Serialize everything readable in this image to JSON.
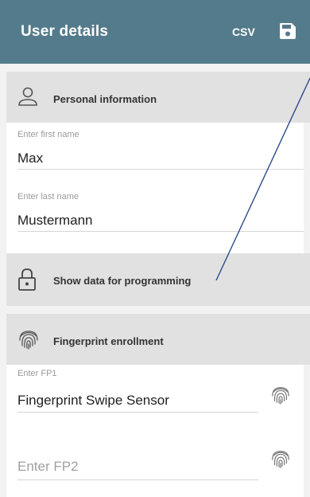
{
  "appbar": {
    "title": "User details",
    "csv_label": "CSV",
    "save_icon": "save-icon",
    "color": "#547b8b"
  },
  "sections": {
    "personal": {
      "label": "Personal information",
      "icon": "person-icon"
    },
    "programming": {
      "label": "Show data for programming",
      "icon": "lock-icon"
    },
    "fingerprint": {
      "label": "Fingerprint enrollment",
      "icon": "fingerprint-icon"
    }
  },
  "fields": {
    "first_name": {
      "label": "Enter first name",
      "value": "Max"
    },
    "last_name": {
      "label": "Enter last name",
      "value": "Mustermann"
    },
    "fp1": {
      "label": "Enter FP1",
      "value": "Fingerprint Swipe Sensor",
      "icon": "fingerprint-icon"
    },
    "fp2": {
      "placeholder": "Enter FP2",
      "icon": "fingerprint-icon"
    }
  },
  "annotation_color": "#2b4b8a"
}
